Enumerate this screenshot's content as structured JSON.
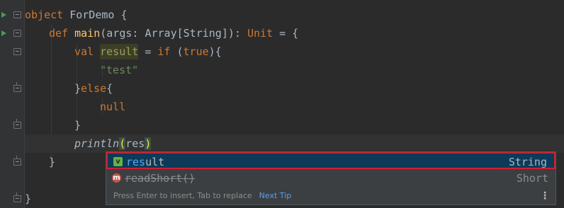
{
  "code": {
    "l1_kw": "object",
    "l1_name": " ForDemo {",
    "l2_kw": "def",
    "l2_fn": "main",
    "l2_open": "(args: ",
    "l2_type": "Array[String]",
    "l2_colon": "): ",
    "l2_unit": "Unit",
    "l2_end": " = {",
    "l3_val": "val",
    "l3_var": "result",
    "l3_eq": " = ",
    "l3_if": "if",
    "l3_sp": " (",
    "l3_true": "true",
    "l3_close": "){",
    "l4_str": "\"test\"",
    "l5_close": "}",
    "l5_else": "else",
    "l5_open": "{",
    "l6_null": "null",
    "l7_close": "}",
    "l8_println": "println",
    "l8_paren_open": "(",
    "l8_typed": "res",
    "l8_paren_close": ")",
    "l9_close": "}",
    "l11_close": "}"
  },
  "completion": {
    "items": [
      {
        "icon": "v",
        "name_match": "res",
        "name_rest": "ult",
        "type": "String"
      },
      {
        "icon": "m",
        "name": "readShort",
        "suffix": "()",
        "type": "Short"
      }
    ],
    "footer_hint": "Press Enter to insert, Tab to replace",
    "next_tip": "Next Tip",
    "more": "⋮"
  }
}
